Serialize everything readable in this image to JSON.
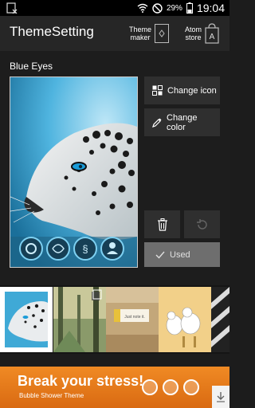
{
  "status_bar": {
    "battery_pct": "29%",
    "time": "19:04"
  },
  "app_bar": {
    "title": "ThemeSetting",
    "theme_maker_line1": "Theme",
    "theme_maker_line2": "maker",
    "atom_store_line1": "Atom",
    "atom_store_line2": "store",
    "atom_store_letter": "A"
  },
  "theme": {
    "name": "Blue Eyes",
    "change_icon_label": "Change icon",
    "change_color_line1": "Change",
    "change_color_line2": "color",
    "used_label": "Used"
  },
  "ad": {
    "title": "Break your stress!",
    "subtitle": "Bubble Shower Theme",
    "sticky_note": "Just note it."
  },
  "colors": {
    "accent_sky": "#3fa9d6",
    "used_button": "#6e6e6e",
    "ad_orange": "#f08a24"
  }
}
